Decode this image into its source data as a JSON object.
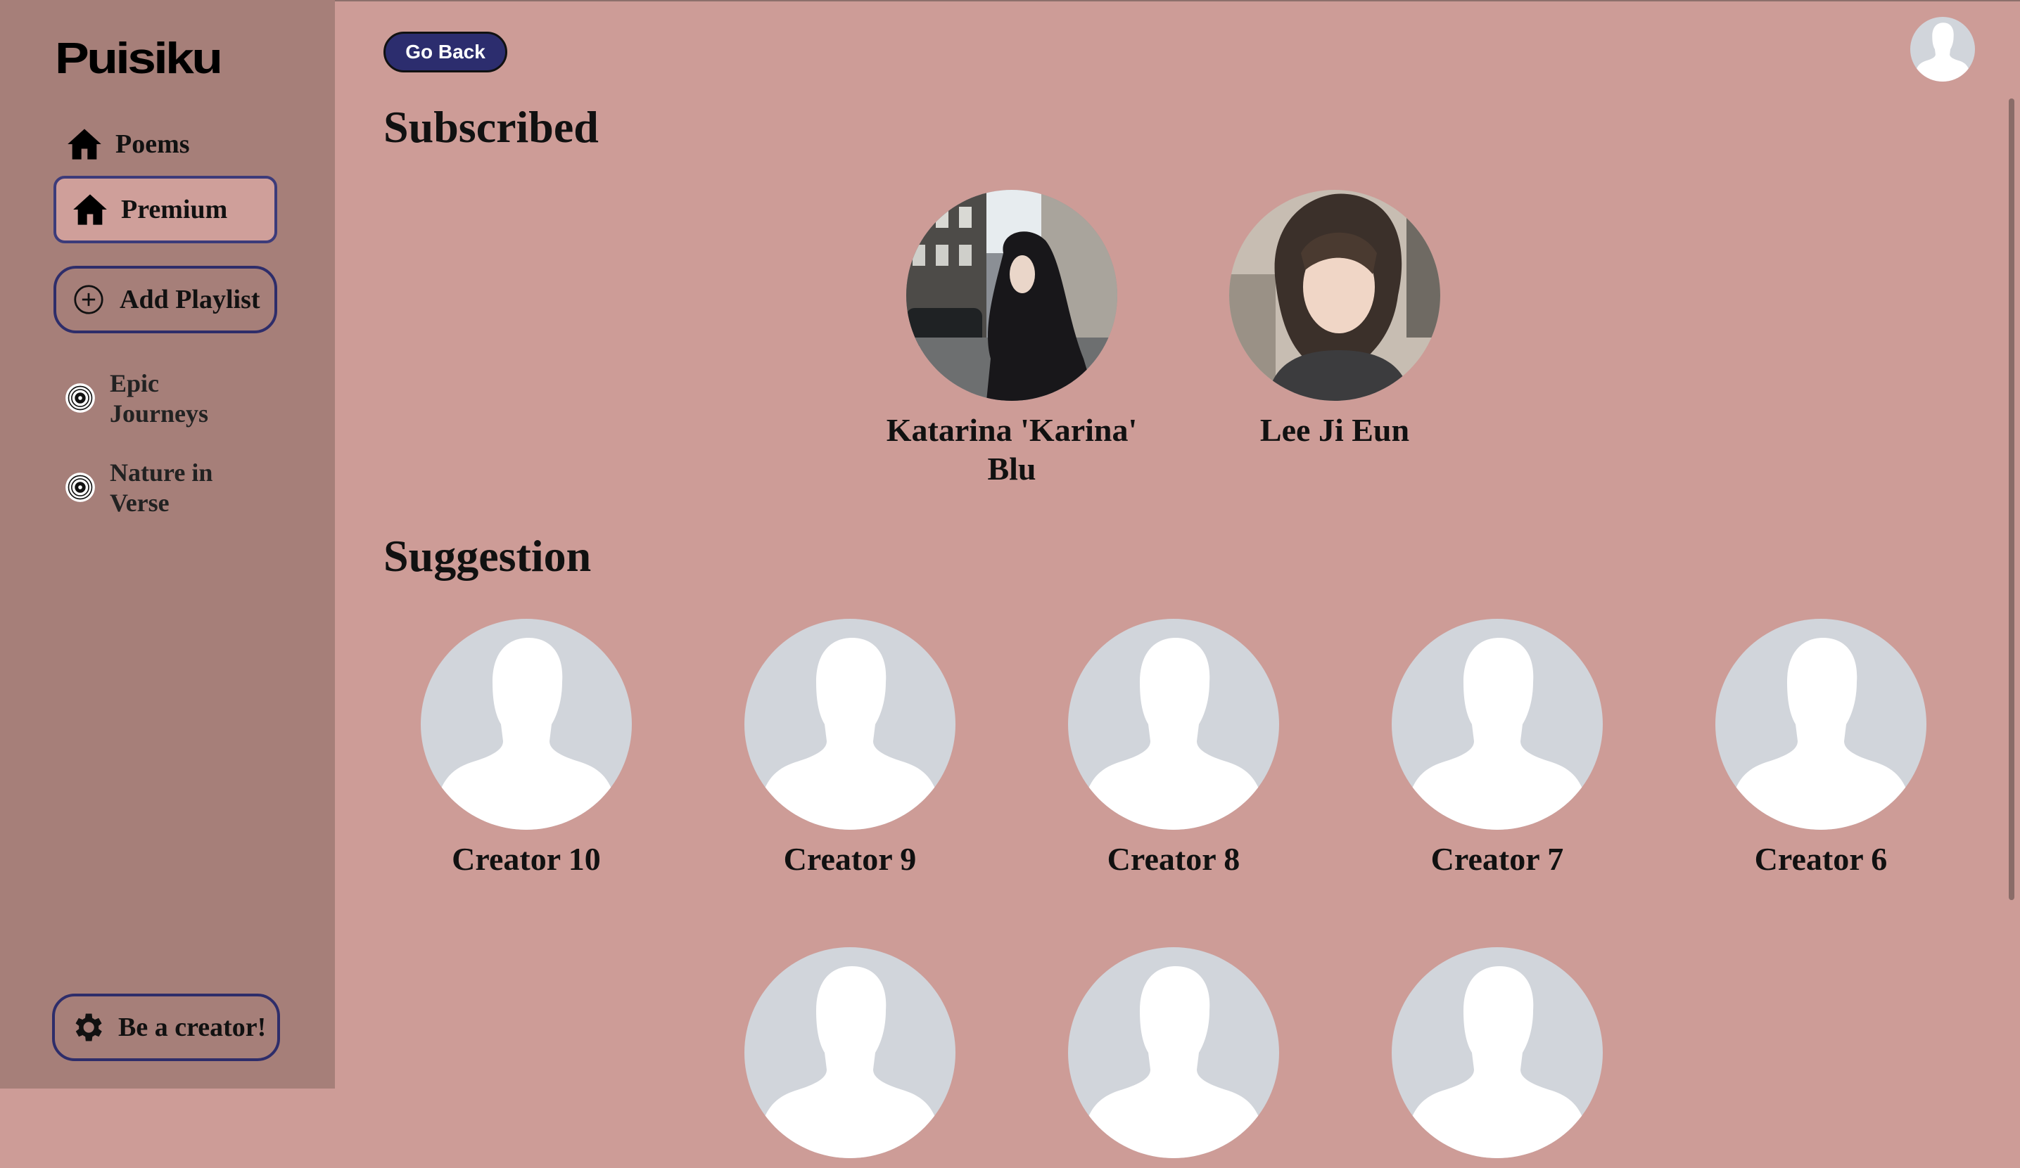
{
  "app": {
    "logo": "Puisiku"
  },
  "sidebar": {
    "nav": [
      {
        "label": "Poems",
        "icon": "home-icon"
      },
      {
        "label": "Premium",
        "icon": "home-icon",
        "active": true
      }
    ],
    "add_playlist_label": "Add Playlist",
    "playlists": [
      {
        "line1": "Epic",
        "line2": "Journeys",
        "icon": "vinyl-disc-icon"
      },
      {
        "line1": "Nature in",
        "line2": "Verse",
        "icon": "vinyl-disc-icon"
      }
    ],
    "creator_button_label": "Be a creator!"
  },
  "header": {
    "go_back_label": "Go Back",
    "profile_icon": "user-avatar-icon"
  },
  "subscribed": {
    "title": "Subscribed",
    "creators": [
      {
        "name": "Katarina 'Karina' Blu",
        "photo": "photo"
      },
      {
        "name": "Lee Ji Eun",
        "photo": "photo"
      }
    ]
  },
  "suggestion": {
    "title": "Suggestion",
    "creators": [
      {
        "name": "Creator 10"
      },
      {
        "name": "Creator 9"
      },
      {
        "name": "Creator 8"
      },
      {
        "name": "Creator 7"
      },
      {
        "name": "Creator 6"
      },
      {
        "name": ""
      },
      {
        "name": ""
      },
      {
        "name": ""
      }
    ]
  },
  "colors": {
    "main_bg": "#cd9c97",
    "sidebar_bg": "#a67f79",
    "accent_navy": "#2c2d6e",
    "placeholder_avatar": "#d1d5db"
  }
}
